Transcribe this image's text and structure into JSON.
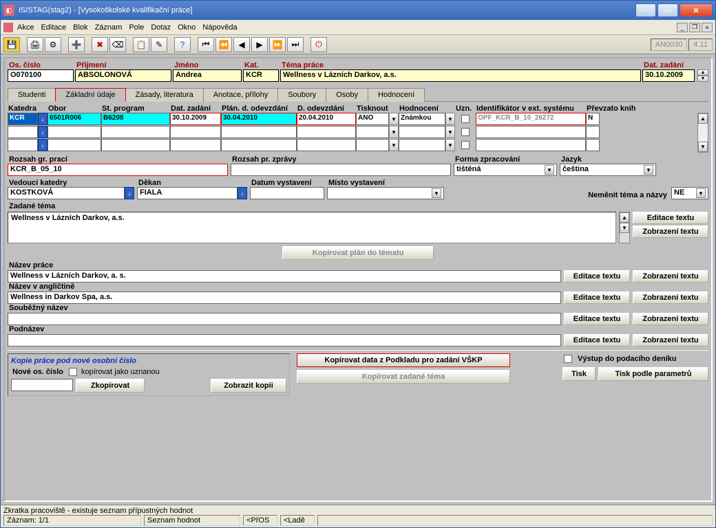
{
  "window": {
    "title": "IS/STAG(stag2) - [Vysokoškolské kvalifikační práce]"
  },
  "menu": [
    "Akce",
    "Editace",
    "Blok",
    "Záznam",
    "Pole",
    "Dotaz",
    "Okno",
    "Nápověda"
  ],
  "toolbar_right": {
    "code": "AN0030",
    "ver": "4.11"
  },
  "header": {
    "os_cislo_lbl": "Os. číslo",
    "os_cislo": "O070100",
    "prijmeni_lbl": "Příjmení",
    "prijmeni": "ABSOLONOVÁ",
    "jmeno_lbl": "Jméno",
    "jmeno": "Andrea",
    "kat_lbl": "Kat.",
    "kat": "KCR",
    "tema_lbl": "Téma práce",
    "tema": "Wellness v Lázních Darkov, a.s.",
    "dat_zadani_lbl": "Dat. zadání",
    "dat_zadani": "30.10.2009"
  },
  "tabs": [
    "Studenti",
    "Základní údaje",
    "Zásady, literatura",
    "Anotace, přílohy",
    "Soubory",
    "Osoby",
    "Hodnocení"
  ],
  "active_tab": 1,
  "grid": {
    "headers": [
      "Katedra",
      "Obor",
      "St. program",
      "Dat. zadání",
      "Plán. d. odevzdání",
      "D. odevzdání",
      "Tisknout",
      "Hodnocení",
      "Uzn.",
      "Identifikátor v ext. systému",
      "Převzato knih"
    ],
    "row": {
      "katedra": "KCR",
      "obor": "6501R006",
      "program": "B6208",
      "dat_zadani": "30.10.2009",
      "plan_odevzdani": "30.04.2010",
      "d_odevzdani": "20.04.2010",
      "tisknout": "ANO",
      "hodnoceni": "Známkou",
      "ident": "OPF_KCR_B_10_26272",
      "prevzato": "N"
    }
  },
  "mid": {
    "rozsah_gr_lbl": "Rozsah gr. prací",
    "rozsah_gr": "KCR_B_05_10",
    "rozsah_pr_lbl": "Rozsah pr. zprávy",
    "rozsah_pr": "",
    "forma_lbl": "Forma zpracování",
    "forma": "tištěná",
    "jazyk_lbl": "Jazyk",
    "jazyk": "čeština",
    "vedouci_lbl": "Vedoucí katedry",
    "vedouci": "KOSTKOVÁ",
    "dekan_lbl": "Děkan",
    "dekan": "FIALA",
    "datum_vyst_lbl": "Datum vystavení",
    "datum_vyst": "",
    "misto_vyst_lbl": "Místo vystavení",
    "misto_vyst": "",
    "nemenit_lbl": "Neměnit téma a názvy",
    "nemenit": "NE"
  },
  "tema_sec": {
    "zadane_lbl": "Zadané téma",
    "zadane": "Wellness v Lázních Darkov, a.s.",
    "editace_btn": "Editace textu",
    "zobrazeni_btn": "Zobrazení textu",
    "kopirovat_plan_btn": "Kopírovat plán do tématu"
  },
  "names": {
    "nazev_lbl": "Název práce",
    "nazev": "Wellness v Lázních Darkov, a. s.",
    "nazev_en_lbl": "Název v angličtině",
    "nazev_en": "Wellness in Darkov Spa, a.s.",
    "soubezny_lbl": "Souběžný název",
    "soubezny": "",
    "podnazev_lbl": "Podnázev",
    "podnazev": ""
  },
  "bottom": {
    "kopie_hdr": "Kopie práce pod nové osobní číslo",
    "nove_os_lbl": "Nové os. číslo",
    "kop_uzn_lbl": "kopírovat jako uznanou",
    "zkopirovat_btn": "Zkopírovat",
    "zobrazit_kopii_btn": "Zobrazit kopii",
    "kop_data_btn": "Kopírovat data z Podkladu pro zadání VŠKP",
    "kop_zadane_btn": "Kopírovat zadané téma",
    "vystup_lbl": "Výstup do podacího deníku",
    "tisk_btn": "Tisk",
    "tisk_param_btn": "Tisk podle parametrů"
  },
  "status": {
    "hint": "Zkratka pracoviště - existuje seznam přípustných hodnot",
    "record": "Záznam: 1/1",
    "seznam": "Seznam hodnot",
    "pros": "<PřOS",
    "lade": "<Ladě"
  }
}
